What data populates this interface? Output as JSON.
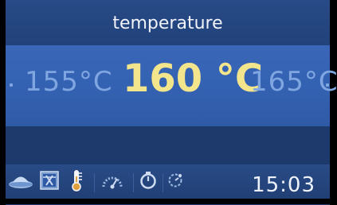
{
  "header": {
    "title": "temperature"
  },
  "selector": {
    "previous_value": "155°C",
    "current_value": "160 °C",
    "next_value": "165°C"
  },
  "status_bar": {
    "icons": [
      "dome-icon",
      "fan-mode-icon",
      "thermometer-icon",
      "power-level-icon",
      "timer-icon",
      "delay-icon"
    ],
    "time": "15:03"
  },
  "colors": {
    "background": "#1d3a6b",
    "band": "#3563b4",
    "selected_text": "#f3e58c",
    "inactive_text": "#7fa6e0",
    "thermometer_accent": "#e0a040"
  }
}
